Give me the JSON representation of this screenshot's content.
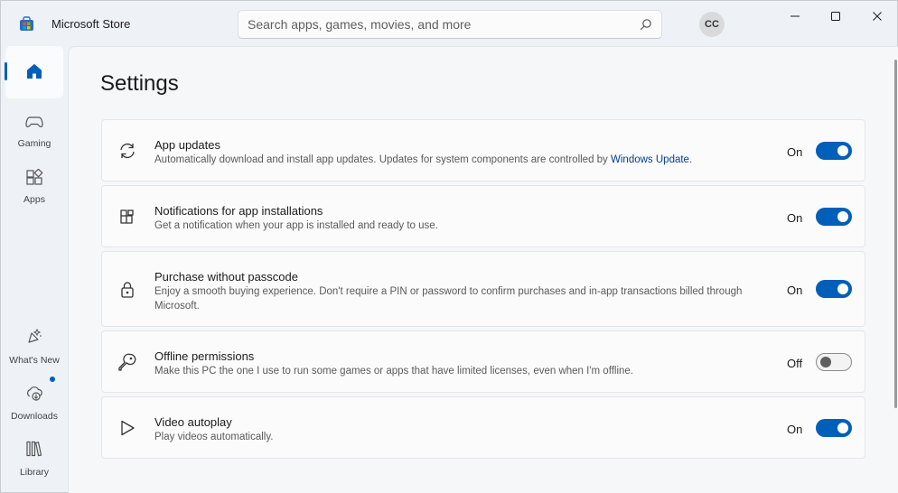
{
  "app": {
    "title": "Microsoft Store",
    "colors": {
      "accent": "#005fb8",
      "link": "#003e92",
      "background": "#eef1f6"
    }
  },
  "search": {
    "placeholder": "Search apps, games, movies, and more",
    "value": ""
  },
  "user": {
    "initials": "CC"
  },
  "window_controls": [
    "minimize",
    "maximize",
    "close"
  ],
  "sidebar": {
    "items": [
      {
        "id": "home",
        "label": "",
        "icon": "home-icon",
        "selected": true
      },
      {
        "id": "gaming",
        "label": "Gaming",
        "icon": "gamepad-icon"
      },
      {
        "id": "apps",
        "label": "Apps",
        "icon": "apps-grid-icon"
      },
      {
        "id": "whats-new",
        "label": "What's New",
        "icon": "sparkle-bell-icon"
      },
      {
        "id": "downloads",
        "label": "Downloads",
        "icon": "cloud-download-icon",
        "badge": true
      },
      {
        "id": "library",
        "label": "Library",
        "icon": "library-icon"
      }
    ]
  },
  "page": {
    "title": "Settings"
  },
  "settings": [
    {
      "id": "app-updates",
      "icon": "sync-icon",
      "title": "App updates",
      "description": "Automatically download and install app updates. Updates for system components are controlled by",
      "link": "Windows Update",
      "description_suffix": ".",
      "state": "On",
      "enabled": true
    },
    {
      "id": "notifications",
      "icon": "app-install-icon",
      "title": "Notifications for app installations",
      "description": "Get a notification when your app is installed and ready to use.",
      "state": "On",
      "enabled": true
    },
    {
      "id": "purchase",
      "icon": "lock-icon",
      "title": "Purchase without passcode",
      "description": "Enjoy a smooth buying experience. Don't require a PIN or password to confirm purchases and in-app transactions billed through Microsoft.",
      "state": "On",
      "enabled": true
    },
    {
      "id": "offline",
      "icon": "key-icon",
      "title": "Offline permissions",
      "description": "Make this PC the one I use to run some games or apps that have limited licenses, even when I'm offline.",
      "state": "Off",
      "enabled": false
    },
    {
      "id": "video-autoplay",
      "icon": "play-icon",
      "title": "Video autoplay",
      "description": "Play videos automatically.",
      "state": "On",
      "enabled": true
    }
  ]
}
